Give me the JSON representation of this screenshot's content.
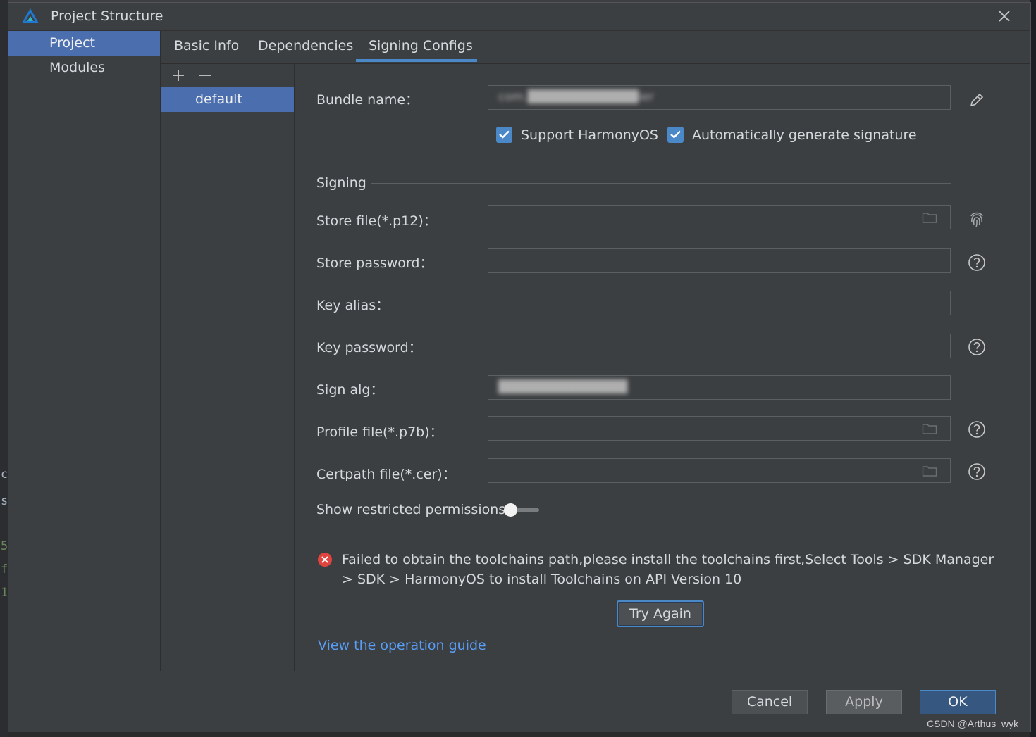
{
  "window": {
    "title": "Project Structure"
  },
  "background": {
    "left_edge_chars": [
      "c",
      "s",
      "5",
      "f",
      "1"
    ]
  },
  "nav": {
    "items": [
      {
        "label": "Project",
        "selected": true
      },
      {
        "label": "Modules",
        "selected": false
      }
    ]
  },
  "tabs": [
    {
      "label": "Basic Info",
      "active": false
    },
    {
      "label": "Dependencies",
      "active": false
    },
    {
      "label": "Signing Configs",
      "active": true
    }
  ],
  "configs": {
    "items": [
      {
        "label": "default",
        "selected": true
      }
    ]
  },
  "form": {
    "bundle_name": {
      "label": "Bundle name：",
      "value": "com.████████████ier"
    },
    "checkboxes": [
      {
        "label": "Support HarmonyOS",
        "checked": true
      },
      {
        "label": "Automatically generate signature",
        "checked": true
      }
    ],
    "signing_section": "Signing",
    "store_file": {
      "label": "Store file(*.p12)：",
      "value": ""
    },
    "store_password": {
      "label": "Store password：",
      "value": ""
    },
    "key_alias": {
      "label": "Key alias：",
      "value": ""
    },
    "key_password": {
      "label": "Key password：",
      "value": ""
    },
    "sign_alg": {
      "label": "Sign alg：",
      "value": "██████████████"
    },
    "profile_file": {
      "label": "Profile file(*.p7b)：",
      "value": ""
    },
    "certpath_file": {
      "label": "Certpath file(*.cer)：",
      "value": ""
    },
    "show_restricted": {
      "label": "Show restricted permissions",
      "enabled": false
    }
  },
  "error": {
    "message": "Failed to obtain the toolchains path,please install the toolchains first,Select Tools > SDK Manager > SDK > HarmonyOS to install Toolchains on API Version 10"
  },
  "try_again": "Try Again",
  "guide_link": "View the operation guide",
  "footer": {
    "cancel": "Cancel",
    "apply": "Apply",
    "ok": "OK"
  },
  "watermark": "CSDN @Arthus_wyk",
  "colors": {
    "accent": "#4a88c7",
    "selection": "#4b6eaf",
    "link": "#589df6",
    "error": "#e0443e",
    "panel": "#3c3f41"
  },
  "icons": [
    "app-logo-icon",
    "close-icon",
    "add-icon",
    "remove-icon",
    "edit-icon",
    "checkbox-checked-icon",
    "folder-icon",
    "fingerprint-icon",
    "help-icon",
    "error-icon",
    "toggle-switch"
  ]
}
